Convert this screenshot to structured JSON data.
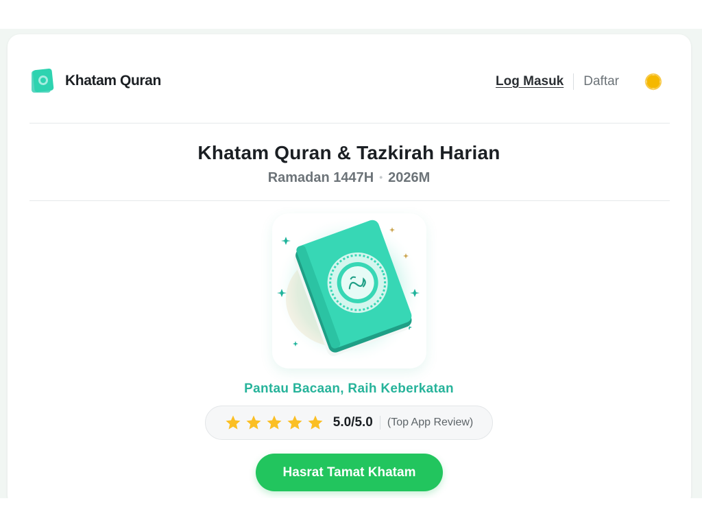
{
  "header": {
    "brand_name": "Khatam Quran",
    "login_label": "Log Masuk",
    "register_label": "Daftar",
    "theme_icon": "sun-icon"
  },
  "hero": {
    "title": "Khatam Quran & Tazkirah Harian",
    "hijri_year": "Ramadan 1447H",
    "separator": "•",
    "gregorian_year": "2026M",
    "image_icon": "quran-book-icon",
    "tagline": "Pantau Bacaan, Raih Keberkatan"
  },
  "rating": {
    "stars": 5,
    "score": "5.0/5.0",
    "note": "(Top App Review)"
  },
  "cta": {
    "label": "Hasrat Tamat Khatam"
  },
  "colors": {
    "brand_teal": "#2ed3b0",
    "tagline": "#26b39a",
    "cta": "#22c55e",
    "star": "#fbbf24",
    "sun": "#f5b800"
  }
}
